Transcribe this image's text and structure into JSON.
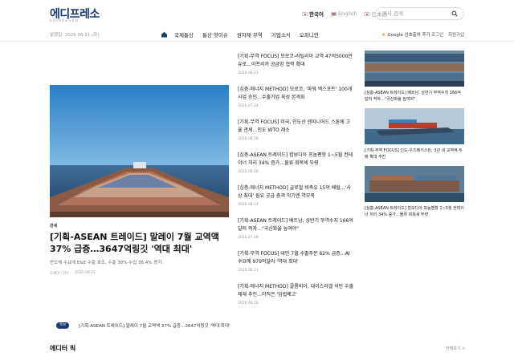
{
  "header": {
    "logo": "에디프레소",
    "logo_sub": "EDIPRESSO",
    "languages": [
      {
        "label": "한국어",
        "active": true
      },
      {
        "label": "English",
        "active": false
      },
      {
        "label": "日本語",
        "active": false
      }
    ],
    "search_placeholder": "기사 검색"
  },
  "navbar": {
    "date": "발행일: 2026.08.11 (화)",
    "items": [
      "국제통상",
      "통상 핫이슈",
      "원자재 무역",
      "기업소식",
      "오피니언"
    ],
    "google_pref": "Google 선호출처 추가",
    "login": "로그인",
    "signup": "회원가입"
  },
  "lead": {
    "category": "관세",
    "title": "[기획-ASEAN 트레이드] 말레이 7월 교역액 37% 급증…3647억링깃 '역대 최대'",
    "summary": "반도체 수요에 E&E 수출 호조, 수출 38%·수입 36.4% 증가.",
    "author": "오세야 기자",
    "date": "2026.08.21"
  },
  "mid_list": [
    {
      "title": "[기획-무역 FOCUS] 모로코-라틸리아 교역 47억5000만유로…아프리카 공급망 협력 확대",
      "date": "2026.08.21"
    },
    {
      "title": "[심층-에너지 METHOD] 모로코, '파워 엑스포트' 100개 사업 승인…수출기업 육성 본격화",
      "date": "2026.07.24"
    },
    {
      "title": "[기획-무역 FOCUS] 미국, 인도산 엔지니어드 스톤에 고율 관세…인도 WTO 제소",
      "date": "2026.08.18"
    },
    {
      "title": "[심층-ASEAN 트레이드] 캄보디아 프놈펜항 1~5월 컨테이너 처리 34% 증가…물류 회복세 뚜렷",
      "date": "2026.08.18"
    },
    {
      "title": "[심층-에너지 METHOD] 글로벌 비축유 15억 배럴…'사상 최대' 원유 공급 충격 막기엔 역부족",
      "date": "2026.08.14"
    },
    {
      "title": "[기획-ASEAN 트레이드] 베트남, 상반기 무역수지 166억 달러 적자…\"국산화율 높여야\"",
      "date": "2026.07.08"
    },
    {
      "title": "[기획-무역 FOCUS] 대만 7월 수출주문 62% 급증…AI 수요에 979억달러 '역대 최대'",
      "date": "2026.08.21"
    },
    {
      "title": "[기획-에너지 METHOD] 콜롬비아, 대이스라엘 석탄 수출 제재 추진…아직은 '입법예고'",
      "date": "2026.08.18"
    }
  ],
  "right_list": [
    {
      "title": "[심층-ASEAN 트레이드] 베트남, 상반기 무역수지 166억 달러 적자…\"국산화율 높여야\""
    },
    {
      "title": "[기획-무역 FOCUS] 인도-우즈베키스탄, 3년 내 교역액 두 배 확대 추진"
    },
    {
      "title": "[심층-ASEAN 트레이드] 캄보디아 프놈펜항 1~5월 컨테이너 처리 34% 증가…물류 회복세 뚜렷"
    }
  ],
  "ticker": {
    "badge": "속보",
    "text": "[기획-ASEAN 트레이드] 말레이 7월 교역액 37% 급증…3647억링깃 '역대 최대'"
  },
  "section": {
    "title": "에디터 픽",
    "more": "전체보기 >"
  }
}
